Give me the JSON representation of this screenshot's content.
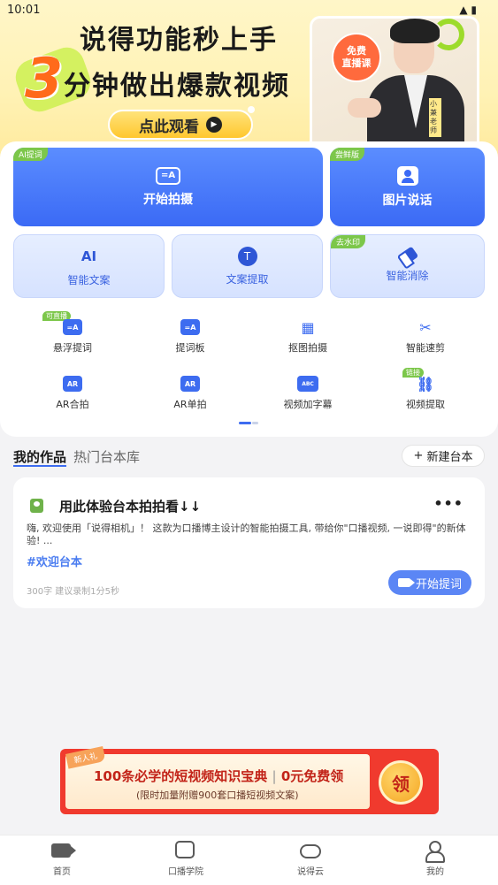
{
  "status_bar": {
    "time": "10:01"
  },
  "banner": {
    "line1": "说得功能秒上手",
    "number": "3",
    "line2": "分钟做出爆款视频",
    "watch_label": "点此观看",
    "badge_line1": "免费",
    "badge_line2": "直播课",
    "teacher_tag": "小兼老师"
  },
  "primary": {
    "start_shoot": {
      "tag": "AI提词",
      "label": "开始拍摄",
      "icon_text": "=A"
    },
    "photo_talk": {
      "tag": "尝鲜版",
      "label": "图片说话"
    }
  },
  "secondary": {
    "smart_copy": {
      "label": "智能文案",
      "icon_text": "AI"
    },
    "extract_copy": {
      "label": "文案提取",
      "icon_text": "T"
    },
    "smart_erase": {
      "tag": "去水印",
      "label": "智能消除"
    }
  },
  "tools": [
    {
      "label": "悬浮提词",
      "tag": "可直播",
      "icon": "=A"
    },
    {
      "label": "提词板",
      "tag": "",
      "icon": "=A"
    },
    {
      "label": "抠图拍摄",
      "tag": "",
      "icon": "▦"
    },
    {
      "label": "智能速剪",
      "tag": "",
      "icon": "✂"
    },
    {
      "label": "AR合拍",
      "tag": "",
      "icon": "AR"
    },
    {
      "label": "AR单拍",
      "tag": "",
      "icon": "AR"
    },
    {
      "label": "视频加字幕",
      "tag": "",
      "icon": "ABC"
    },
    {
      "label": "视频提取",
      "tag": "链接",
      "icon": "⛓"
    }
  ],
  "tabs": {
    "active": "我的作品",
    "other": "热门台本库",
    "new_label": "新建台本"
  },
  "card": {
    "title": "用此体验台本拍拍看↓↓",
    "more": "•••",
    "body": "嗨, 欢迎使用「说得相机」！ 这款为口播博主设计的智能拍摄工具, 带给你\"口播视频, 一说即得\"的新体验! ...",
    "tag": "#欢迎台本",
    "meta": "300字 建议录制1分5秒",
    "action_label": "开始提词"
  },
  "promo": {
    "ribbon": "新人礼",
    "line1_a": "100条必学的短视频知识宝典",
    "line1_b": "0元免费领",
    "line2": "(限时加量附赠900套口播短视频文案)",
    "claim": "领"
  },
  "nav": [
    {
      "label": "首页",
      "icon": "video-icon"
    },
    {
      "label": "口播学院",
      "icon": "academy-icon"
    },
    {
      "label": "说得云",
      "icon": "cloud-icon"
    },
    {
      "label": "我的",
      "icon": "profile-icon"
    }
  ]
}
